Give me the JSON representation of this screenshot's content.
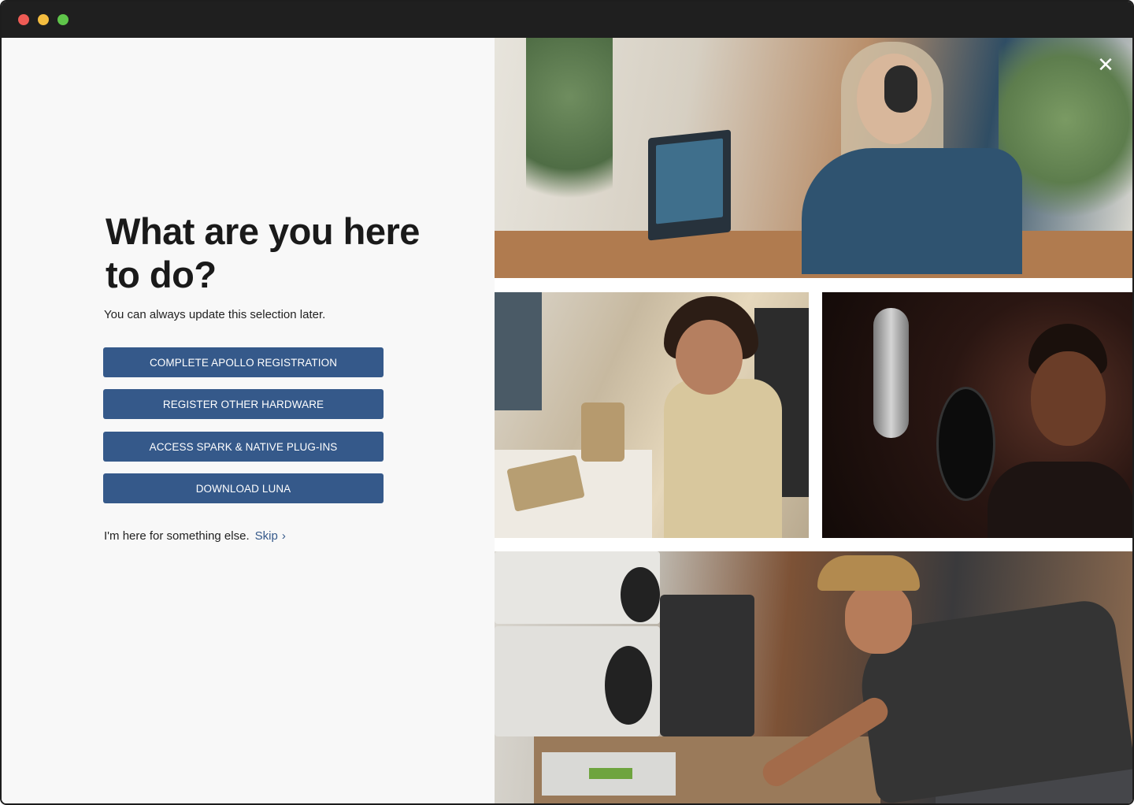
{
  "dialog": {
    "heading": "What are you here to do?",
    "subtext": "You can always update this selection later.",
    "buttons": [
      {
        "label": "COMPLETE APOLLO REGISTRATION"
      },
      {
        "label": "REGISTER OTHER HARDWARE"
      },
      {
        "label": "ACCESS SPARK & NATIVE PLUG-INS"
      },
      {
        "label": "DOWNLOAD LUNA"
      }
    ],
    "else_text": "I'm here for something else.",
    "skip_label": "Skip",
    "skip_icon": "chevron-right-icon",
    "close_icon": "close-icon"
  },
  "colors": {
    "button_bg": "#35598a",
    "button_text": "#ffffff",
    "link": "#35598a",
    "titlebar": "#1f1f1f",
    "panel_bg": "#f8f8f8"
  }
}
